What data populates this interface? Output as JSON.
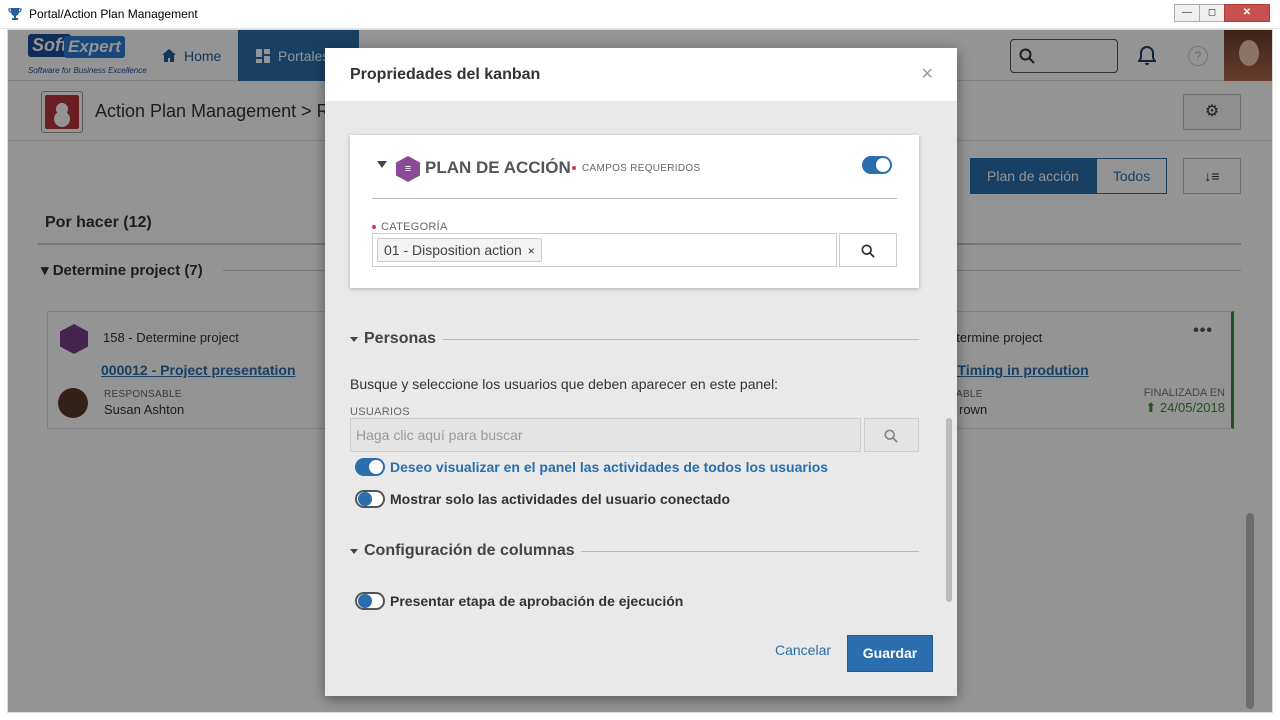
{
  "window": {
    "title": "Portal/Action Plan Management",
    "min_icon": "minimize-icon",
    "max_icon": "maximize-icon",
    "close_icon": "close-icon"
  },
  "nav": {
    "logo_soft": "Soft",
    "logo_expert": "Expert",
    "logo_tagline": "Software for Business Excellence",
    "home": "Home",
    "portales": "Portales",
    "help": "?"
  },
  "header": {
    "breadcrumb": "Action Plan Management > R"
  },
  "board": {
    "filters": [
      "Plan de acción",
      "Todos"
    ],
    "active_filter": "Plan de acción",
    "column_title": "Por hacer (12)",
    "group_title": "Determine project (7)",
    "cards": [
      {
        "code": "158 - Determine project",
        "link": "000012 - Project presentation",
        "responsible_label": "RESPONSABLE",
        "responsible": "Susan Ashton"
      },
      {
        "code": "etermine project",
        "link": "- Timing in prodution",
        "responsible_label": "SABLE",
        "responsible": "rown",
        "finished_label": "FINALIZADA EN",
        "finished_date": "24/05/2018",
        "menu": "•••"
      }
    ]
  },
  "modal": {
    "title": "Propriedades del kanban",
    "close": "×",
    "plan": {
      "title": "PLAN DE ACCIÓN",
      "required_note": "CAMPOS REQUERIDOS",
      "enabled": true,
      "category_label": "CATEGORÍA",
      "category_chip": "01 - Disposition action",
      "chip_remove": "×"
    },
    "personas": {
      "title": "Personas",
      "description": "Busque y seleccione los usuarios que deben aparecer en este panel:",
      "users_label": "USUARIOS",
      "users_placeholder": "Haga clic aquí para buscar",
      "option_all": "Deseo visualizar en el panel las actividades de todos los usuarios",
      "option_all_on": true,
      "option_mine": "Mostrar solo las actividades del usuario conectado",
      "option_mine_on": false
    },
    "columns": {
      "title": "Configuración de columnas",
      "option_approval": "Presentar etapa de aprobación de ejecución",
      "option_approval_on": false
    },
    "cancel": "Cancelar",
    "save": "Guardar"
  },
  "colors": {
    "accent": "#2a6ead",
    "required": "#d9394a",
    "done": "#3b8e3b",
    "plan_icon": "#8a4a96"
  }
}
